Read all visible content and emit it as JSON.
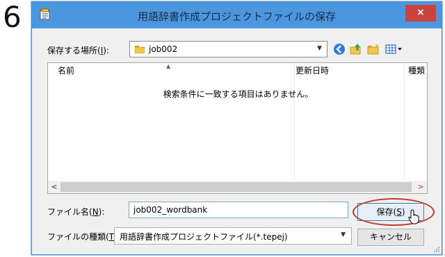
{
  "step_number": "6",
  "dialog": {
    "title": "用語辞書作成プロジェクトファイルの保存",
    "close_glyph": "×",
    "location_label_prefix": "保存する場所(",
    "location_label_key": "I",
    "location_label_suffix": "):",
    "location_value": "job002",
    "toolbar_icons": [
      "back-icon",
      "up-folder-icon",
      "new-folder-icon",
      "view-menu-icon"
    ],
    "columns": [
      "名前",
      "更新日時",
      "種類"
    ],
    "empty_message": "検索条件に一致する項目はありません。",
    "filename_label_prefix": "ファイル名(",
    "filename_label_key": "N",
    "filename_label_suffix": "):",
    "filename_value": "job002_wordbank",
    "filetype_label_prefix": "ファイルの種類(",
    "filetype_label_key": "T",
    "filetype_label_suffix": "):",
    "filetype_value": "用語辞書作成プロジェクトファイル(*.tepej)",
    "save_label_prefix": "保存(",
    "save_label_key": "S",
    "save_label_suffix": ")",
    "cancel_label": "キャンセル"
  },
  "colors": {
    "titlebar": "#4a97df",
    "close": "#c9423b",
    "highlight_ring": "#c0392b"
  }
}
